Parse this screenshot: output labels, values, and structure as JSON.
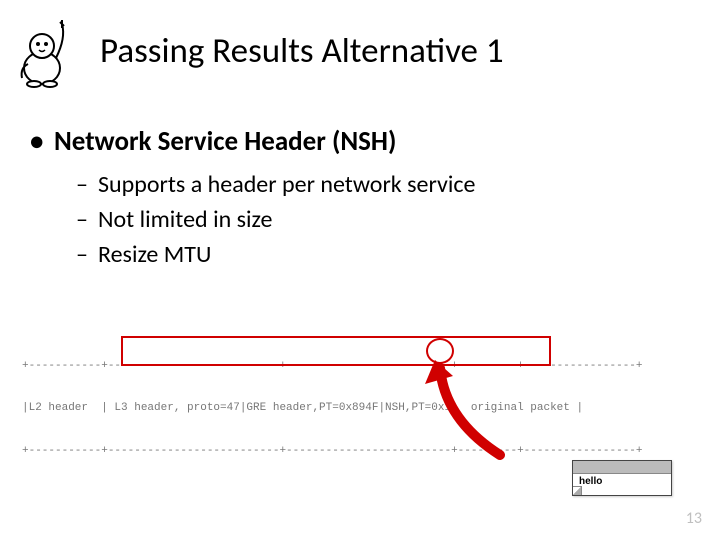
{
  "title": "Passing Results Alternative 1",
  "list": {
    "l1": "Network Service Header (NSH)",
    "sub": {
      "a": "Supports a header per network service",
      "b": "Not limited in size",
      "c": "Resize MTU"
    }
  },
  "packet": {
    "border": "+-----------+--------------------------+-------------------------+---------+-----------------+",
    "row": "|L2 header  | L3 header, proto=47|GRE header,PT=0x894F|NSH,PT=0x1|  original packet |"
  },
  "note": "hello",
  "page": "13"
}
